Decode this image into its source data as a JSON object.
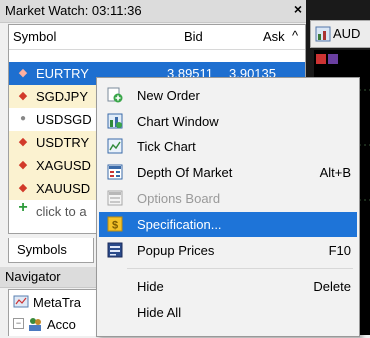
{
  "market_watch": {
    "title": "Market Watch: 03:11:36",
    "close": "×",
    "columns": {
      "symbol": "Symbol",
      "bid": "Bid",
      "ask": "Ask"
    },
    "sort_arrow": "^",
    "rows": [
      {
        "symbol": "EURTRY",
        "bid": "3.89511",
        "ask": "3.90135"
      },
      {
        "symbol": "SGDJPY"
      },
      {
        "symbol": "USDSGD"
      },
      {
        "symbol": "USDTRY"
      },
      {
        "symbol": "XAGUSD"
      },
      {
        "symbol": "XAUUSD"
      }
    ],
    "add_row": "click to a",
    "tab_symbols": "Symbols"
  },
  "navigator": {
    "title": "Navigator",
    "items": [
      {
        "label": "MetaTra"
      },
      {
        "label": "Acco"
      }
    ]
  },
  "chart": {
    "tab_label": "AUD"
  },
  "context_menu": {
    "items": [
      {
        "label": "New Order",
        "icon": "new-order-icon"
      },
      {
        "label": "Chart Window",
        "icon": "chart-window-icon"
      },
      {
        "label": "Tick Chart",
        "icon": "tick-chart-icon"
      },
      {
        "label": "Depth Of Market",
        "shortcut": "Alt+B",
        "icon": "depth-of-market-icon"
      },
      {
        "label": "Options Board",
        "icon": "options-board-icon",
        "disabled": true
      },
      {
        "label": "Specification...",
        "icon": "specification-icon",
        "highlighted": true
      },
      {
        "label": "Popup Prices",
        "shortcut": "F10",
        "icon": "popup-prices-icon"
      },
      {
        "label": "Hide",
        "shortcut": "Delete"
      },
      {
        "label": "Hide All"
      }
    ]
  },
  "colors": {
    "selection": "#1e74d8",
    "up_arrow": "#d23a2a",
    "add": "#2c9a3a"
  }
}
